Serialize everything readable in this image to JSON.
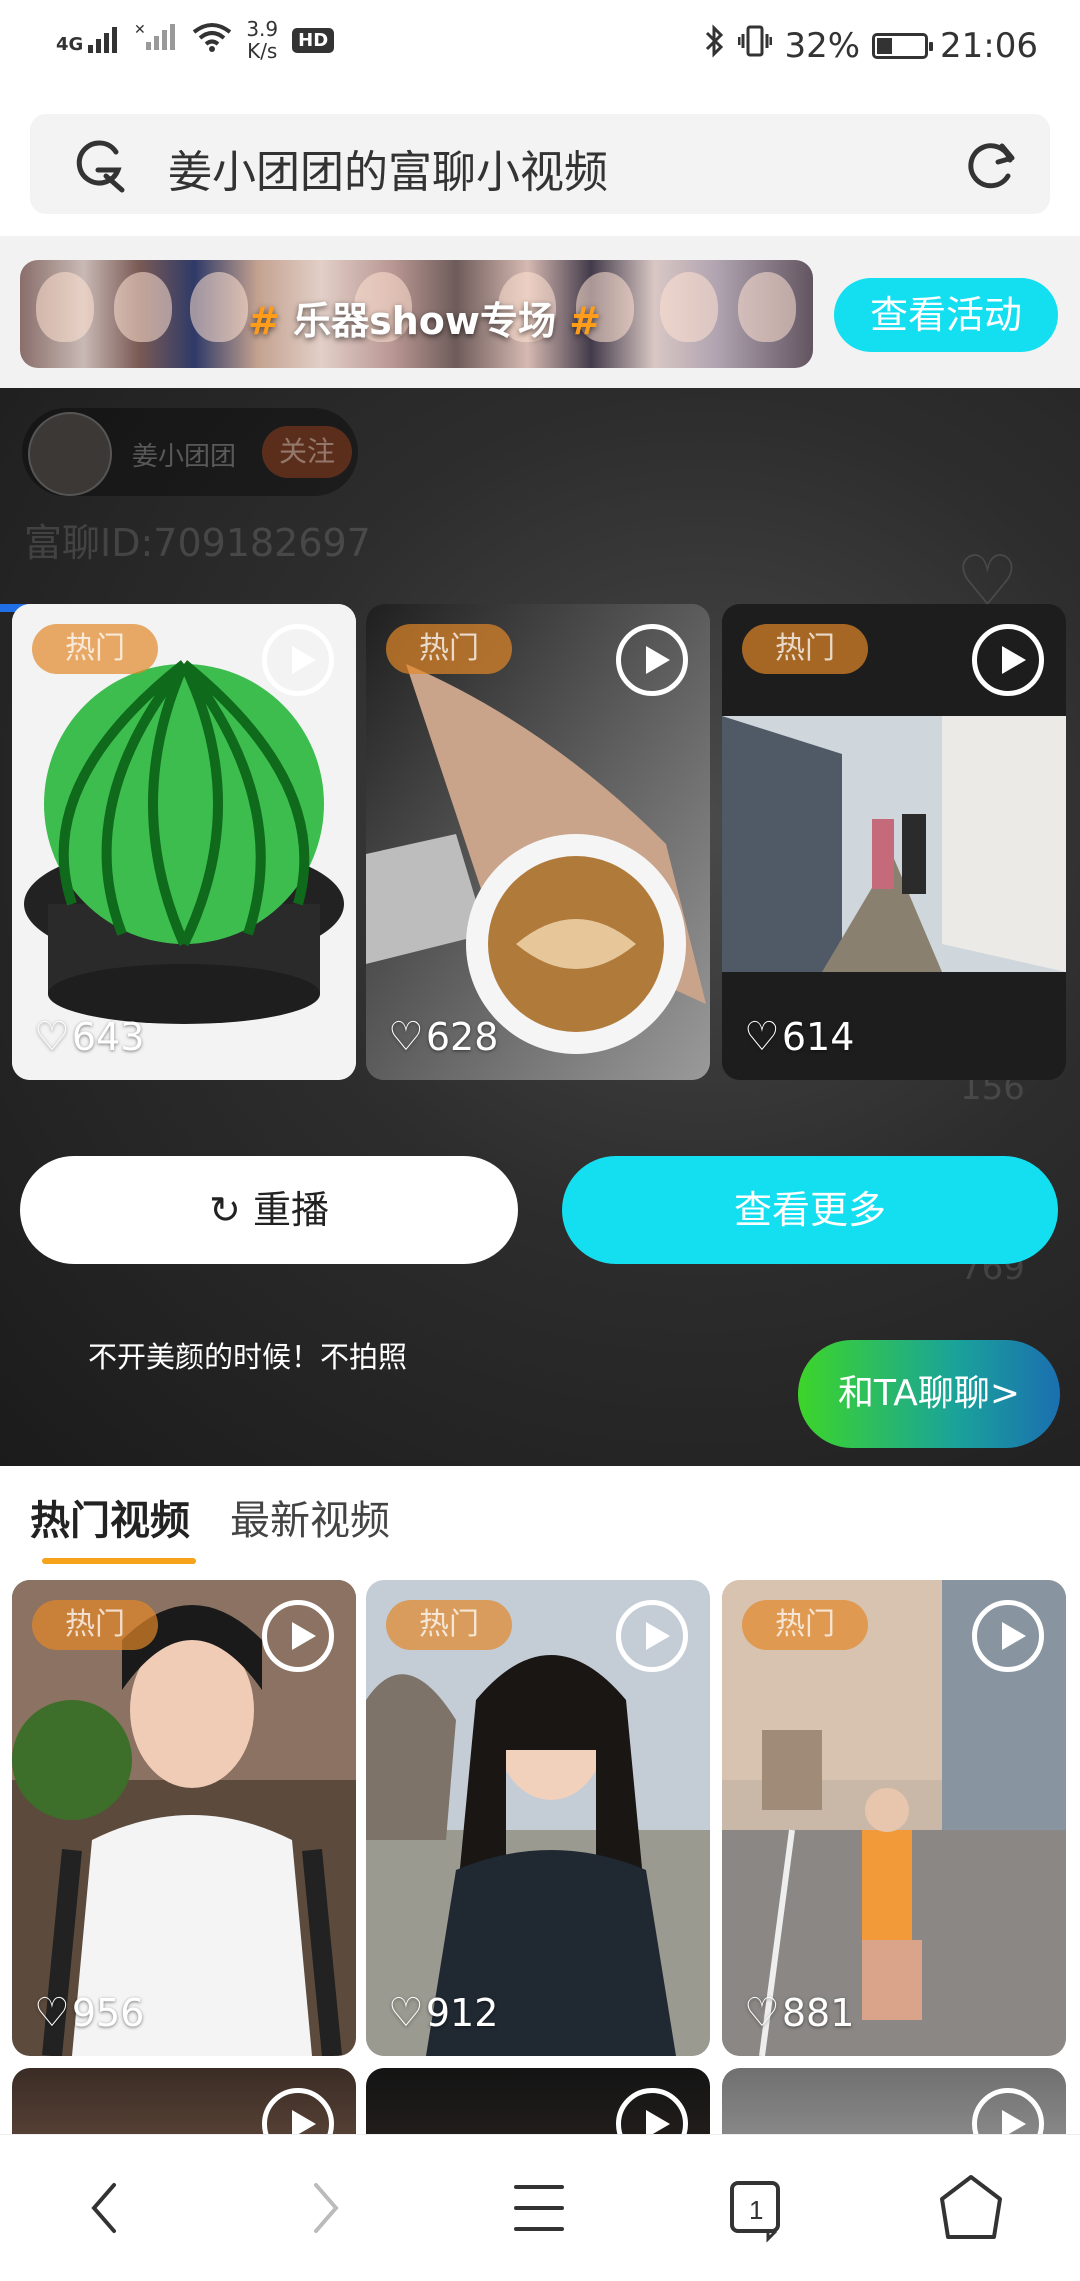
{
  "status_bar": {
    "net": "4G",
    "net_speed_value": "3.9",
    "net_speed_unit": "K/s",
    "hd": "HD",
    "battery_percent": "32%",
    "battery_level": 0.32,
    "time": "21:06"
  },
  "search": {
    "query": "姜小团团的富聊小视频",
    "search_icon": "search-g-icon",
    "refresh_icon": "refresh-icon"
  },
  "banner": {
    "hash_left": "#",
    "title": " 乐器show专场 ",
    "hash_right": "#",
    "button_label": "查看活动"
  },
  "player": {
    "user_name": "姜小团团",
    "follow_label": "关注",
    "user_id": "富聊ID:709182697",
    "side_count_1": "156",
    "side_count_2": "769",
    "replay_label": "↻ 重播",
    "more_label": "查看更多",
    "caption": "不开美颜的时候！不拍照",
    "chat_label": "和TA聊聊>"
  },
  "recommended": [
    {
      "tag": "热门",
      "likes": "643"
    },
    {
      "tag": "热门",
      "likes": "628"
    },
    {
      "tag": "热门",
      "likes": "614"
    }
  ],
  "tabs": {
    "active": "热门视频",
    "inactive": "最新视频"
  },
  "videos": [
    {
      "tag": "热门",
      "likes": "956"
    },
    {
      "tag": "热门",
      "likes": "912"
    },
    {
      "tag": "热门",
      "likes": "881"
    }
  ],
  "colors": {
    "accent_cyan": "#14dff0",
    "tab_underline": "#f7a21b",
    "hot_tag": "#e28728",
    "progress": "#1f6fe6"
  }
}
